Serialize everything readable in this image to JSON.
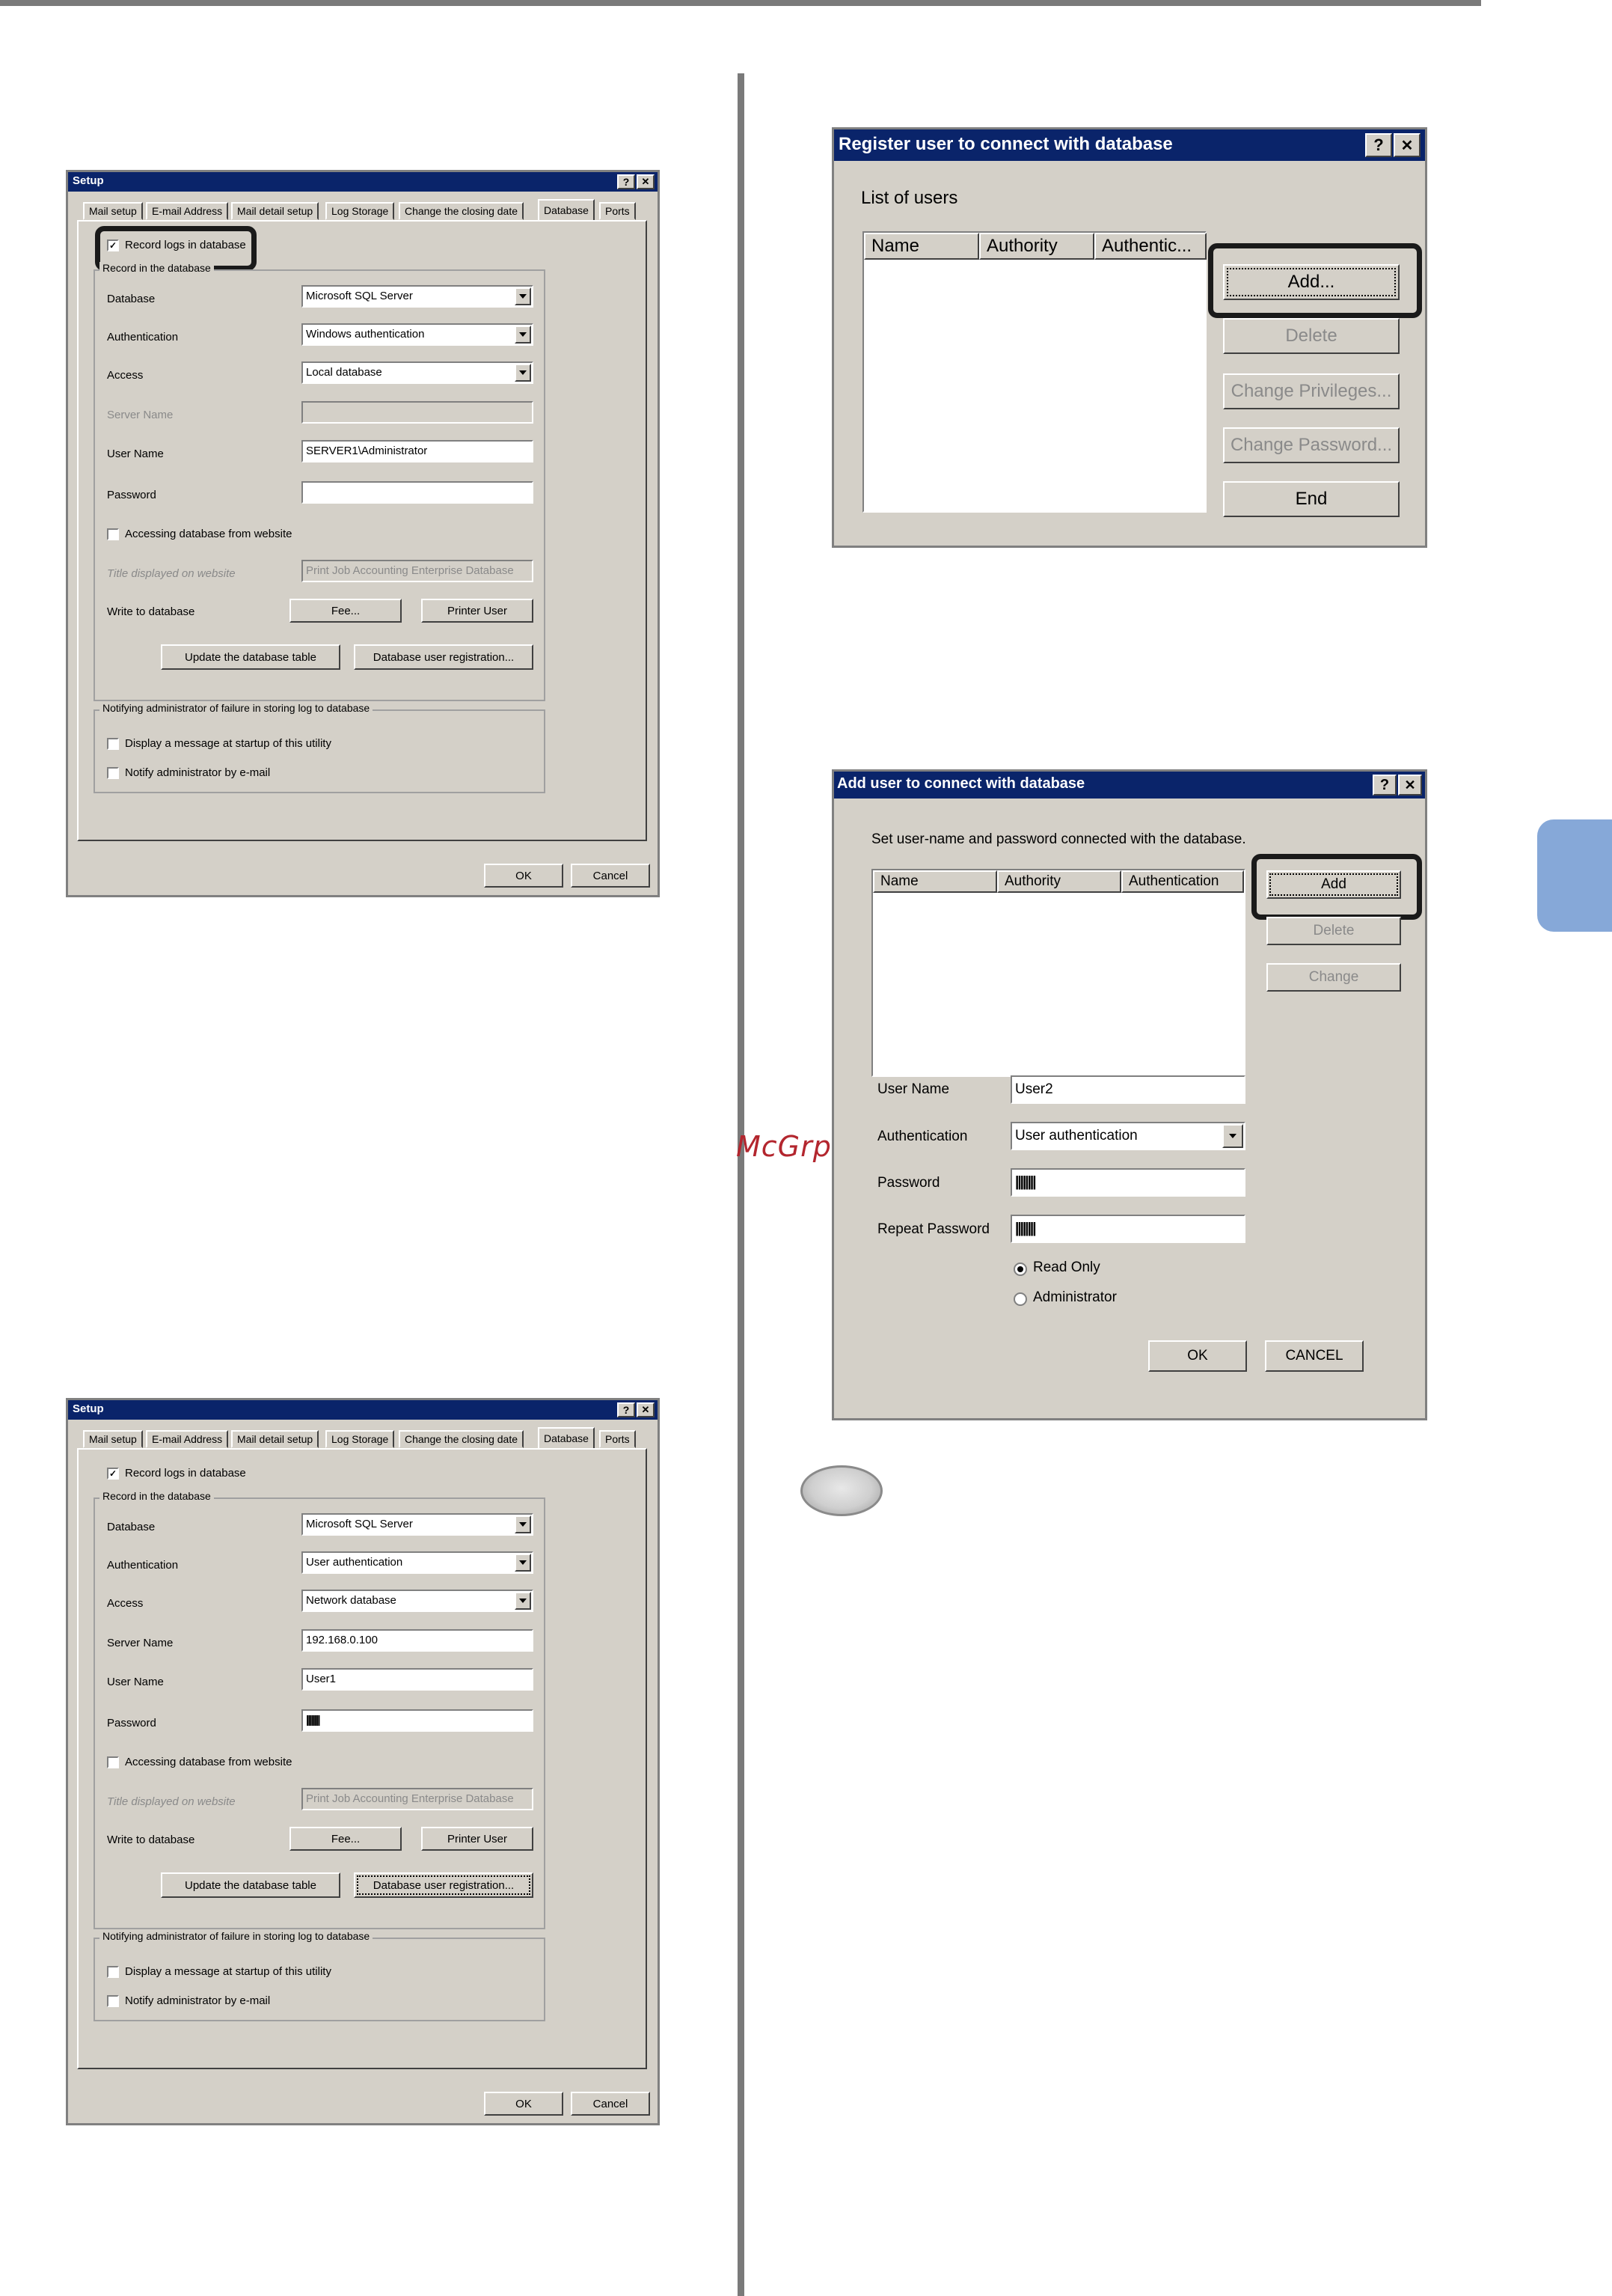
{
  "watermark": "McGrp.Ru",
  "setup1": {
    "title": "Setup",
    "help_btn": "?",
    "close_btn": "✕",
    "tabs": [
      "Mail setup",
      "E-mail Address",
      "Mail detail setup",
      "Log Storage",
      "Change the closing date",
      "Database",
      "Ports"
    ],
    "record_logs_label": "Record logs in database",
    "record_logs_checked": "✓",
    "group_record": "Record in the database",
    "database_label": "Database",
    "database_value": "Microsoft SQL Server",
    "auth_label": "Authentication",
    "auth_value": "Windows authentication",
    "access_label": "Access",
    "access_value": "Local database",
    "server_label": "Server Name",
    "server_value": "",
    "user_label": "User Name",
    "user_value": "SERVER1\\Administrator",
    "password_label": "Password",
    "password_value": "",
    "website_label": "Accessing database from website",
    "title_web_label": "Title displayed on website",
    "title_web_value": "Print Job Accounting Enterprise Database",
    "write_label": "Write to database",
    "fee_btn": "Fee...",
    "printer_user_btn": "Printer User",
    "update_table_btn": "Update the database table",
    "db_user_reg_btn": "Database user registration...",
    "group_notify": "Notifying administrator of failure in storing log to database",
    "display_msg_label": "Display a message at startup of this utility",
    "notify_email_label": "Notify administrator by e-mail",
    "ok_btn": "OK",
    "cancel_btn": "Cancel"
  },
  "setup2": {
    "title": "Setup",
    "help_btn": "?",
    "close_btn": "✕",
    "tabs": [
      "Mail setup",
      "E-mail Address",
      "Mail detail setup",
      "Log Storage",
      "Change the closing date",
      "Database",
      "Ports"
    ],
    "record_logs_label": "Record logs in database",
    "record_logs_checked": "✓",
    "group_record": "Record in the database",
    "database_label": "Database",
    "database_value": "Microsoft SQL Server",
    "auth_label": "Authentication",
    "auth_value": "User authentication",
    "access_label": "Access",
    "access_value": "Network database",
    "server_label": "Server Name",
    "server_value": "192.168.0.100",
    "user_label": "User Name",
    "user_value": "User1",
    "password_label": "Password",
    "password_value": "||||||||",
    "website_label": "Accessing database from website",
    "title_web_label": "Title displayed on website",
    "title_web_value": "Print Job Accounting Enterprise Database",
    "write_label": "Write to database",
    "fee_btn": "Fee...",
    "printer_user_btn": "Printer User",
    "update_table_btn": "Update the database table",
    "db_user_reg_btn": "Database user registration...",
    "group_notify": "Notifying administrator of failure in storing log to database",
    "display_msg_label": "Display a message at startup of this utility",
    "notify_email_label": "Notify administrator by e-mail",
    "ok_btn": "OK",
    "cancel_btn": "Cancel"
  },
  "register": {
    "title": "Register user to connect with database",
    "help_btn": "?",
    "close_btn": "✕",
    "list_label": "List of users",
    "columns": [
      "Name",
      "Authority",
      "Authentic..."
    ],
    "add_btn": "Add...",
    "delete_btn": "Delete",
    "change_priv_btn": "Change Privileges...",
    "change_pwd_btn": "Change Password...",
    "end_btn": "End"
  },
  "adduser": {
    "title": "Add user to connect with database",
    "help_btn": "?",
    "close_btn": "✕",
    "instruction": "Set user-name and password connected with the database.",
    "columns": [
      "Name",
      "Authority",
      "Authentication"
    ],
    "add_btn": "Add",
    "delete_btn": "Delete",
    "change_btn": "Change",
    "user_label": "User Name",
    "user_value": "User2",
    "auth_label": "Authentication",
    "auth_value": "User authentication",
    "password_label": "Password",
    "password_value": "||||||||",
    "repeat_label": "Repeat Password",
    "repeat_value": "||||||||",
    "radio_readonly": "Read Only",
    "radio_admin": "Administrator",
    "ok_btn": "OK",
    "cancel_btn": "CANCEL"
  }
}
